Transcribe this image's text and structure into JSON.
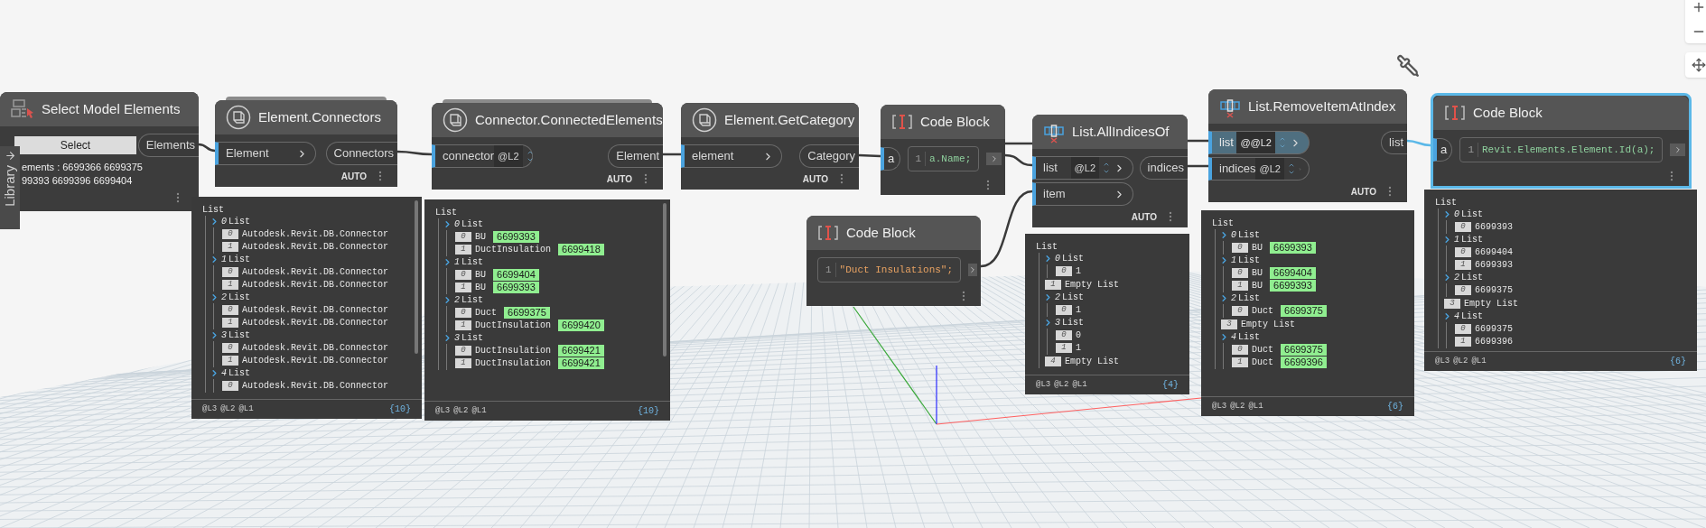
{
  "library_tab": "Library",
  "nodes": [
    {
      "kind": "select",
      "title": "Select Model Elements",
      "selected": false,
      "button": "Select",
      "outputs": [
        "Elements"
      ],
      "lines": [
        "ements : 6699366 6699375",
        "99393 6699396 6699404"
      ]
    },
    {
      "kind": "function",
      "title": "Element.Connectors",
      "selected": false,
      "stacked": true,
      "inputs": [
        {
          "name": "Element",
          "active": false
        }
      ],
      "outputs": [
        "Connectors"
      ],
      "footer": "AUTO",
      "preview": {
        "root": "List",
        "levels": [
          "@L3",
          "@L2",
          "@L1"
        ],
        "count": "{10}",
        "items": [
          {
            "index": "0",
            "text": "List",
            "children": [
              {
                "index": "0",
                "text": "Autodesk.Revit.DB.Connector"
              },
              {
                "index": "1",
                "text": "Autodesk.Revit.DB.Connector"
              }
            ]
          },
          {
            "index": "1",
            "text": "List",
            "children": [
              {
                "index": "0",
                "text": "Autodesk.Revit.DB.Connector"
              },
              {
                "index": "1",
                "text": "Autodesk.Revit.DB.Connector"
              }
            ]
          },
          {
            "index": "2",
            "text": "List",
            "children": [
              {
                "index": "0",
                "text": "Autodesk.Revit.DB.Connector"
              },
              {
                "index": "1",
                "text": "Autodesk.Revit.DB.Connector"
              }
            ]
          },
          {
            "index": "3",
            "text": "List",
            "children": [
              {
                "index": "0",
                "text": "Autodesk.Revit.DB.Connector"
              },
              {
                "index": "1",
                "text": "Autodesk.Revit.DB.Connector"
              }
            ]
          },
          {
            "index": "4",
            "text": "List",
            "children": [
              {
                "index": "0",
                "text": "Autodesk.Revit.DB.Connector"
              }
            ]
          }
        ]
      }
    },
    {
      "kind": "function",
      "title": "Connector.ConnectedElements",
      "selected": false,
      "stacked": true,
      "inputs": [
        {
          "name": "connector",
          "lacing": "@L2",
          "active": false
        }
      ],
      "outputs": [
        "Element"
      ],
      "footer": "AUTO",
      "preview": {
        "root": "List",
        "levels": [
          "@L3",
          "@L2",
          "@L1"
        ],
        "count": "{10}",
        "items": [
          {
            "index": "0",
            "text": "List",
            "children": [
              {
                "index": "0",
                "text": "BU",
                "value": "6699393"
              },
              {
                "index": "1",
                "text": "DuctInsulation",
                "value": "6699418"
              }
            ]
          },
          {
            "index": "1",
            "text": "List",
            "children": [
              {
                "index": "0",
                "text": "BU",
                "value": "6699404"
              },
              {
                "index": "1",
                "text": "BU",
                "value": "6699393"
              }
            ]
          },
          {
            "index": "2",
            "text": "List",
            "children": [
              {
                "index": "0",
                "text": "Duct",
                "value": "6699375"
              },
              {
                "index": "1",
                "text": "DuctInsulation",
                "value": "6699420"
              }
            ]
          },
          {
            "index": "3",
            "text": "List",
            "children": [
              {
                "index": "0",
                "text": "DuctInsulation",
                "value": "6699421"
              },
              {
                "index": "1",
                "text": "DuctInsulation",
                "value": "6699421"
              }
            ]
          }
        ]
      }
    },
    {
      "kind": "function",
      "title": "Element.GetCategory",
      "selected": false,
      "inputs": [
        {
          "name": "element",
          "active": false
        }
      ],
      "outputs": [
        "Category"
      ],
      "footer": "AUTO"
    },
    {
      "kind": "code",
      "title": "Code Block",
      "selected": false,
      "inputs": [
        {
          "name": "a",
          "active": false
        }
      ],
      "line": "1",
      "code": "a.Name;"
    },
    {
      "kind": "code",
      "title": "Code Block",
      "selected": false,
      "line": "1",
      "code": "\"Duct Insulations\";"
    },
    {
      "kind": "list",
      "title": "List.AllIndicesOf",
      "selected": false,
      "inputs": [
        {
          "name": "list",
          "lacing": "@L2",
          "active": false
        },
        {
          "name": "item",
          "active": false
        }
      ],
      "outputs": [
        "indices"
      ],
      "footer": "AUTO",
      "preview": {
        "root": "List",
        "levels": [
          "@L3",
          "@L2",
          "@L1"
        ],
        "count": "{4}",
        "items": [
          {
            "index": "0",
            "text": "List",
            "children": [
              {
                "index": "0",
                "text": "1"
              }
            ]
          },
          {
            "index": "1",
            "text": "Empty List"
          },
          {
            "index": "2",
            "text": "List",
            "children": [
              {
                "index": "0",
                "text": "1"
              }
            ]
          },
          {
            "index": "3",
            "text": "List",
            "children": [
              {
                "index": "0",
                "text": "0"
              },
              {
                "index": "1",
                "text": "1"
              }
            ]
          },
          {
            "index": "4",
            "text": "Empty List"
          }
        ]
      }
    },
    {
      "kind": "list",
      "title": "List.RemoveItemAtIndex",
      "selected": false,
      "inputs": [
        {
          "name": "list",
          "lacing": "@@L2",
          "active": true
        },
        {
          "name": "indices",
          "lacing": "@L2",
          "active": false
        }
      ],
      "outputs": [
        "list"
      ],
      "footer": "AUTO",
      "preview": {
        "root": "List",
        "levels": [
          "@L3",
          "@L2",
          "@L1"
        ],
        "count": "{6}",
        "items": [
          {
            "index": "0",
            "text": "List",
            "children": [
              {
                "index": "0",
                "text": "BU",
                "value": "6699393"
              }
            ]
          },
          {
            "index": "1",
            "text": "List",
            "children": [
              {
                "index": "0",
                "text": "BU",
                "value": "6699404"
              },
              {
                "index": "1",
                "text": "BU",
                "value": "6699393"
              }
            ]
          },
          {
            "index": "2",
            "text": "List",
            "children": [
              {
                "index": "0",
                "text": "Duct",
                "value": "6699375"
              }
            ]
          },
          {
            "index": "3",
            "text": "Empty List"
          },
          {
            "index": "4",
            "text": "List",
            "children": [
              {
                "index": "0",
                "text": "Duct",
                "value": "6699375"
              },
              {
                "index": "1",
                "text": "Duct",
                "value": "6699396"
              }
            ]
          }
        ]
      }
    },
    {
      "kind": "code",
      "title": "Code Block",
      "selected": true,
      "inputs": [
        {
          "name": "a",
          "active": false
        }
      ],
      "line": "1",
      "code": "Revit.Elements.Element.Id(a);",
      "preview": {
        "root": "List",
        "levels": [
          "@L3",
          "@L2",
          "@L1"
        ],
        "count": "{6}",
        "items": [
          {
            "index": "0",
            "text": "List",
            "children": [
              {
                "index": "0",
                "text": "6699393"
              }
            ]
          },
          {
            "index": "1",
            "text": "List",
            "children": [
              {
                "index": "0",
                "text": "6699404"
              },
              {
                "index": "1",
                "text": "6699393"
              }
            ]
          },
          {
            "index": "2",
            "text": "List",
            "children": [
              {
                "index": "0",
                "text": "6699375"
              }
            ]
          },
          {
            "index": "3",
            "text": "Empty List"
          },
          {
            "index": "4",
            "text": "List",
            "children": [
              {
                "index": "0",
                "text": "6699375"
              },
              {
                "index": "1",
                "text": "6699396"
              }
            ]
          }
        ]
      }
    }
  ]
}
